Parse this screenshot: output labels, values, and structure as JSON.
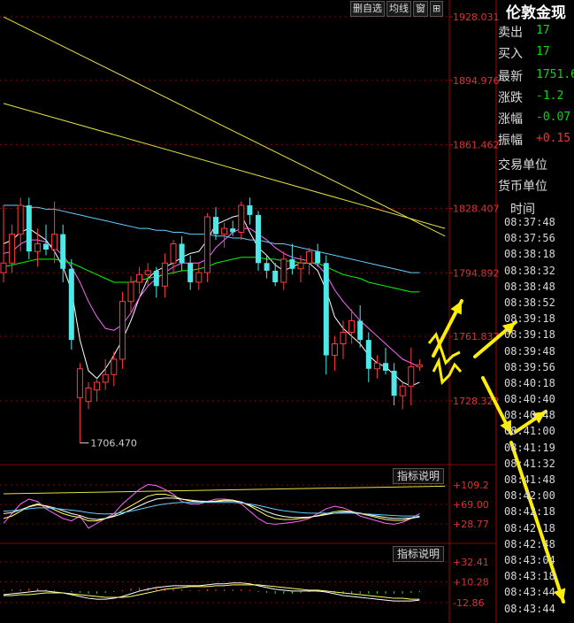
{
  "toolbar": {
    "btn1": "删自选",
    "btn2": "均线",
    "btn3": "窗",
    "btn4": "⊞"
  },
  "panel": {
    "title": "伦敦金现",
    "rows": [
      {
        "label": "卖出",
        "value": "17",
        "color": "#00dd00"
      },
      {
        "label": "买入",
        "value": "17",
        "color": "#00dd00"
      },
      {
        "label": "最新",
        "value": "1751.6",
        "color": "#00dd00"
      },
      {
        "label": "涨跌",
        "value": "-1.2",
        "color": "#00dd00"
      },
      {
        "label": "涨幅",
        "value": "-0.07",
        "color": "#00dd00"
      },
      {
        "label": "振幅",
        "value": "+0.15",
        "color": "#ff3030"
      }
    ],
    "unit_trade": "交易单位",
    "unit_currency": "货币单位",
    "time_header": "时间",
    "times": [
      "08:37:48",
      "08:37:56",
      "08:38:18",
      "08:38:32",
      "08:38:48",
      "08:38:52",
      "08:39:18",
      "08:39:18",
      "08:39:48",
      "08:39:56",
      "08:40:18",
      "08:40:40",
      "08:40:48",
      "08:41:00",
      "08:41:19",
      "08:41:32",
      "08:41:48",
      "08:42:00",
      "08:42:18",
      "08:42:18",
      "08:42:48",
      "08:43:04",
      "08:43:18",
      "08:43:44",
      "08:43:44"
    ]
  },
  "indicator_btn_label": "指标说明",
  "chart_data": {
    "type": "candlestick",
    "price_labels": [
      "1928.031",
      "1894.976",
      "1861.462",
      "1828.407",
      "1794.892",
      "1761.837",
      "1728.322"
    ],
    "price_levels": [
      1928.031,
      1894.976,
      1861.462,
      1828.407,
      1794.892,
      1761.837,
      1728.322
    ],
    "low_marker": {
      "label": "1706.470",
      "value": 1706.47
    },
    "candles": [
      {
        "o": 1795,
        "h": 1830,
        "l": 1790,
        "c": 1800
      },
      {
        "o": 1800,
        "h": 1820,
        "l": 1795,
        "c": 1815
      },
      {
        "o": 1815,
        "h": 1834,
        "l": 1806,
        "c": 1830
      },
      {
        "o": 1830,
        "h": 1834,
        "l": 1802,
        "c": 1806
      },
      {
        "o": 1806,
        "h": 1818,
        "l": 1798,
        "c": 1810
      },
      {
        "o": 1810,
        "h": 1820,
        "l": 1804,
        "c": 1807
      },
      {
        "o": 1807,
        "h": 1832,
        "l": 1800,
        "c": 1815
      },
      {
        "o": 1815,
        "h": 1820,
        "l": 1790,
        "c": 1797
      },
      {
        "o": 1797,
        "h": 1802,
        "l": 1755,
        "c": 1760
      },
      {
        "o": 1730,
        "h": 1748,
        "l": 1706.47,
        "c": 1745
      },
      {
        "o": 1728,
        "h": 1738,
        "l": 1724,
        "c": 1735
      },
      {
        "o": 1734,
        "h": 1740,
        "l": 1728,
        "c": 1738
      },
      {
        "o": 1738,
        "h": 1750,
        "l": 1734,
        "c": 1742
      },
      {
        "o": 1742,
        "h": 1754,
        "l": 1736,
        "c": 1750
      },
      {
        "o": 1750,
        "h": 1785,
        "l": 1745,
        "c": 1780
      },
      {
        "o": 1780,
        "h": 1793,
        "l": 1774,
        "c": 1790
      },
      {
        "o": 1790,
        "h": 1798,
        "l": 1784,
        "c": 1794
      },
      {
        "o": 1794,
        "h": 1800,
        "l": 1788,
        "c": 1796
      },
      {
        "o": 1796,
        "h": 1798,
        "l": 1782,
        "c": 1788
      },
      {
        "o": 1788,
        "h": 1805,
        "l": 1782,
        "c": 1800
      },
      {
        "o": 1800,
        "h": 1812,
        "l": 1794,
        "c": 1810
      },
      {
        "o": 1810,
        "h": 1814,
        "l": 1796,
        "c": 1800
      },
      {
        "o": 1800,
        "h": 1804,
        "l": 1786,
        "c": 1790
      },
      {
        "o": 1790,
        "h": 1800,
        "l": 1786,
        "c": 1795
      },
      {
        "o": 1795,
        "h": 1826,
        "l": 1790,
        "c": 1824
      },
      {
        "o": 1824,
        "h": 1829,
        "l": 1812,
        "c": 1815
      },
      {
        "o": 1815,
        "h": 1821,
        "l": 1808,
        "c": 1818
      },
      {
        "o": 1818,
        "h": 1822,
        "l": 1814,
        "c": 1816
      },
      {
        "o": 1816,
        "h": 1832,
        "l": 1812,
        "c": 1830
      },
      {
        "o": 1830,
        "h": 1834,
        "l": 1820,
        "c": 1825
      },
      {
        "o": 1825,
        "h": 1827,
        "l": 1796,
        "c": 1800
      },
      {
        "o": 1800,
        "h": 1804,
        "l": 1792,
        "c": 1796
      },
      {
        "o": 1796,
        "h": 1800,
        "l": 1788,
        "c": 1790
      },
      {
        "o": 1790,
        "h": 1806,
        "l": 1786,
        "c": 1802
      },
      {
        "o": 1802,
        "h": 1810,
        "l": 1794,
        "c": 1797
      },
      {
        "o": 1797,
        "h": 1804,
        "l": 1790,
        "c": 1800
      },
      {
        "o": 1800,
        "h": 1808,
        "l": 1794,
        "c": 1806
      },
      {
        "o": 1806,
        "h": 1810,
        "l": 1798,
        "c": 1800
      },
      {
        "o": 1800,
        "h": 1804,
        "l": 1742,
        "c": 1752
      },
      {
        "o": 1752,
        "h": 1762,
        "l": 1744,
        "c": 1758
      },
      {
        "o": 1758,
        "h": 1770,
        "l": 1750,
        "c": 1764
      },
      {
        "o": 1764,
        "h": 1776,
        "l": 1758,
        "c": 1770
      },
      {
        "o": 1770,
        "h": 1778,
        "l": 1756,
        "c": 1760
      },
      {
        "o": 1760,
        "h": 1764,
        "l": 1738,
        "c": 1745
      },
      {
        "o": 1745,
        "h": 1752,
        "l": 1740,
        "c": 1748
      },
      {
        "o": 1748,
        "h": 1756,
        "l": 1742,
        "c": 1744
      },
      {
        "o": 1744,
        "h": 1748,
        "l": 1726,
        "c": 1731
      },
      {
        "o": 1731,
        "h": 1738,
        "l": 1724,
        "c": 1736
      },
      {
        "o": 1736,
        "h": 1756,
        "l": 1726,
        "c": 1746
      },
      {
        "o": 1746,
        "h": 1750,
        "l": 1744,
        "c": 1747
      }
    ],
    "ma_series": [
      {
        "color": "#ffffff",
        "values": [
          1810,
          1812,
          1816,
          1818,
          1815,
          1812,
          1806,
          1798,
          1786,
          1760,
          1744,
          1740,
          1745,
          1752,
          1760,
          1770,
          1782,
          1792,
          1796,
          1798,
          1800,
          1803,
          1805,
          1806,
          1812,
          1820,
          1822,
          1824,
          1825,
          1816,
          1808,
          1804,
          1799,
          1796,
          1798,
          1800,
          1800,
          1796,
          1786,
          1772,
          1766,
          1762,
          1758,
          1752,
          1748,
          1746,
          1742,
          1738,
          1736,
          1738
        ]
      },
      {
        "color": "#ff66ff",
        "values": [
          1805,
          1806,
          1810,
          1812,
          1812,
          1811,
          1808,
          1804,
          1798,
          1790,
          1780,
          1772,
          1766,
          1765,
          1768,
          1774,
          1782,
          1788,
          1792,
          1795,
          1798,
          1800,
          1800,
          1800,
          1802,
          1808,
          1812,
          1816,
          1818,
          1818,
          1815,
          1812,
          1808,
          1805,
          1803,
          1802,
          1801,
          1799,
          1794,
          1786,
          1780,
          1775,
          1770,
          1766,
          1762,
          1758,
          1754,
          1750,
          1748,
          1746
        ]
      },
      {
        "color": "#00ff00",
        "values": [
          1798,
          1799,
          1800,
          1801,
          1802,
          1802,
          1802,
          1801,
          1800,
          1798,
          1796,
          1794,
          1792,
          1790,
          1790,
          1790,
          1791,
          1792,
          1793,
          1794,
          1795,
          1796,
          1796,
          1797,
          1798,
          1800,
          1801,
          1802,
          1803,
          1803,
          1803,
          1802,
          1802,
          1801,
          1801,
          1800,
          1800,
          1800,
          1798,
          1796,
          1794,
          1793,
          1792,
          1790,
          1789,
          1788,
          1787,
          1786,
          1785,
          1785
        ]
      },
      {
        "color": "#66ccff",
        "values": [
          1830,
          1830,
          1830,
          1829,
          1829,
          1828,
          1828,
          1827,
          1826,
          1825,
          1824,
          1823,
          1822,
          1821,
          1820,
          1819,
          1818,
          1818,
          1817,
          1817,
          1816,
          1816,
          1815,
          1815,
          1815,
          1814,
          1814,
          1813,
          1813,
          1812,
          1812,
          1811,
          1810,
          1810,
          1809,
          1808,
          1807,
          1806,
          1805,
          1804,
          1803,
          1802,
          1801,
          1800,
          1799,
          1798,
          1797,
          1796,
          1795,
          1795
        ]
      }
    ],
    "trendlines": [
      {
        "from": [
          0,
          1928
        ],
        "to": [
          52,
          1814
        ]
      },
      {
        "from": [
          0,
          1883
        ],
        "to": [
          52,
          1818
        ]
      },
      {
        "from": [
          0,
          1680
        ],
        "to": [
          52,
          1684
        ]
      }
    ],
    "indicator1": {
      "labels": [
        "+109.2",
        "+69.00",
        "+28.77"
      ],
      "levels": [
        109.2,
        69.0,
        28.77
      ],
      "series": [
        {
          "color": "#ff66ff",
          "values": [
            30,
            50,
            70,
            80,
            75,
            60,
            50,
            40,
            35,
            45,
            20,
            30,
            40,
            50,
            70,
            85,
            100,
            110,
            108,
            100,
            90,
            75,
            70,
            70,
            75,
            80,
            80,
            78,
            70,
            55,
            40,
            30,
            28,
            30,
            32,
            35,
            40,
            50,
            60,
            65,
            62,
            55,
            45,
            40,
            35,
            30,
            28,
            32,
            40,
            50
          ]
        },
        {
          "color": "#ffff66",
          "values": [
            40,
            45,
            55,
            65,
            70,
            65,
            58,
            50,
            45,
            42,
            35,
            35,
            40,
            46,
            56,
            66,
            76,
            86,
            90,
            90,
            86,
            80,
            76,
            74,
            74,
            76,
            78,
            78,
            74,
            66,
            56,
            46,
            40,
            38,
            38,
            40,
            42,
            46,
            50,
            54,
            56,
            54,
            50,
            46,
            42,
            38,
            36,
            36,
            40,
            44
          ]
        },
        {
          "color": "#ffffff",
          "values": [
            50,
            52,
            58,
            64,
            68,
            66,
            62,
            56,
            50,
            46,
            40,
            38,
            40,
            44,
            50,
            58,
            66,
            74,
            80,
            82,
            82,
            80,
            78,
            76,
            75,
            75,
            76,
            76,
            74,
            68,
            62,
            54,
            48,
            44,
            42,
            42,
            43,
            45,
            48,
            51,
            53,
            53,
            51,
            48,
            45,
            42,
            40,
            40,
            41,
            43
          ]
        },
        {
          "color": "#66ccff",
          "values": [
            55,
            56,
            58,
            60,
            62,
            62,
            61,
            59,
            57,
            55,
            52,
            50,
            49,
            50,
            52,
            55,
            59,
            63,
            67,
            70,
            72,
            73,
            73,
            73,
            73,
            73,
            73,
            73,
            72,
            70,
            67,
            63,
            59,
            56,
            54,
            52,
            51,
            51,
            51,
            51,
            51,
            51,
            50,
            49,
            48,
            47,
            46,
            45,
            45,
            45
          ]
        }
      ]
    },
    "indicator2": {
      "labels": [
        "+32.41",
        "+10.28",
        "-12.86"
      ],
      "levels": [
        32.41,
        10.28,
        -12.86
      ],
      "line1": {
        "color": "#ffffff",
        "values": [
          -4,
          -3,
          -2,
          -1,
          0,
          0,
          -1,
          -2,
          -4,
          -6,
          -8,
          -9,
          -9,
          -8,
          -6,
          -3,
          0,
          2,
          4,
          5,
          6,
          6,
          6,
          6,
          7,
          8,
          8,
          9,
          9,
          8,
          6,
          4,
          2,
          1,
          0,
          0,
          0,
          0,
          -1,
          -3,
          -5,
          -6,
          -7,
          -8,
          -9,
          -10,
          -11,
          -11,
          -11,
          -10
        ]
      },
      "line2": {
        "color": "#ffff66",
        "values": [
          -5,
          -5,
          -4,
          -4,
          -3,
          -2,
          -2,
          -2,
          -3,
          -4,
          -5,
          -6,
          -7,
          -7,
          -7,
          -6,
          -4,
          -2,
          0,
          2,
          3,
          4,
          5,
          5,
          5,
          6,
          6,
          7,
          7,
          7,
          7,
          6,
          5,
          4,
          3,
          2,
          1,
          1,
          0,
          -1,
          -2,
          -3,
          -4,
          -5,
          -6,
          -7,
          -8,
          -8,
          -9,
          -9
        ]
      },
      "bars": [
        1,
        2,
        2,
        3,
        3,
        2,
        1,
        0,
        -1,
        -2,
        -3,
        -3,
        -2,
        -1,
        1,
        3,
        4,
        4,
        4,
        3,
        3,
        2,
        1,
        1,
        2,
        2,
        2,
        2,
        2,
        1,
        -1,
        -2,
        -3,
        -3,
        -3,
        -2,
        -1,
        -1,
        -1,
        -2,
        -3,
        -3,
        -3,
        -3,
        -3,
        -3,
        -3,
        -3,
        -2,
        -1
      ]
    }
  }
}
